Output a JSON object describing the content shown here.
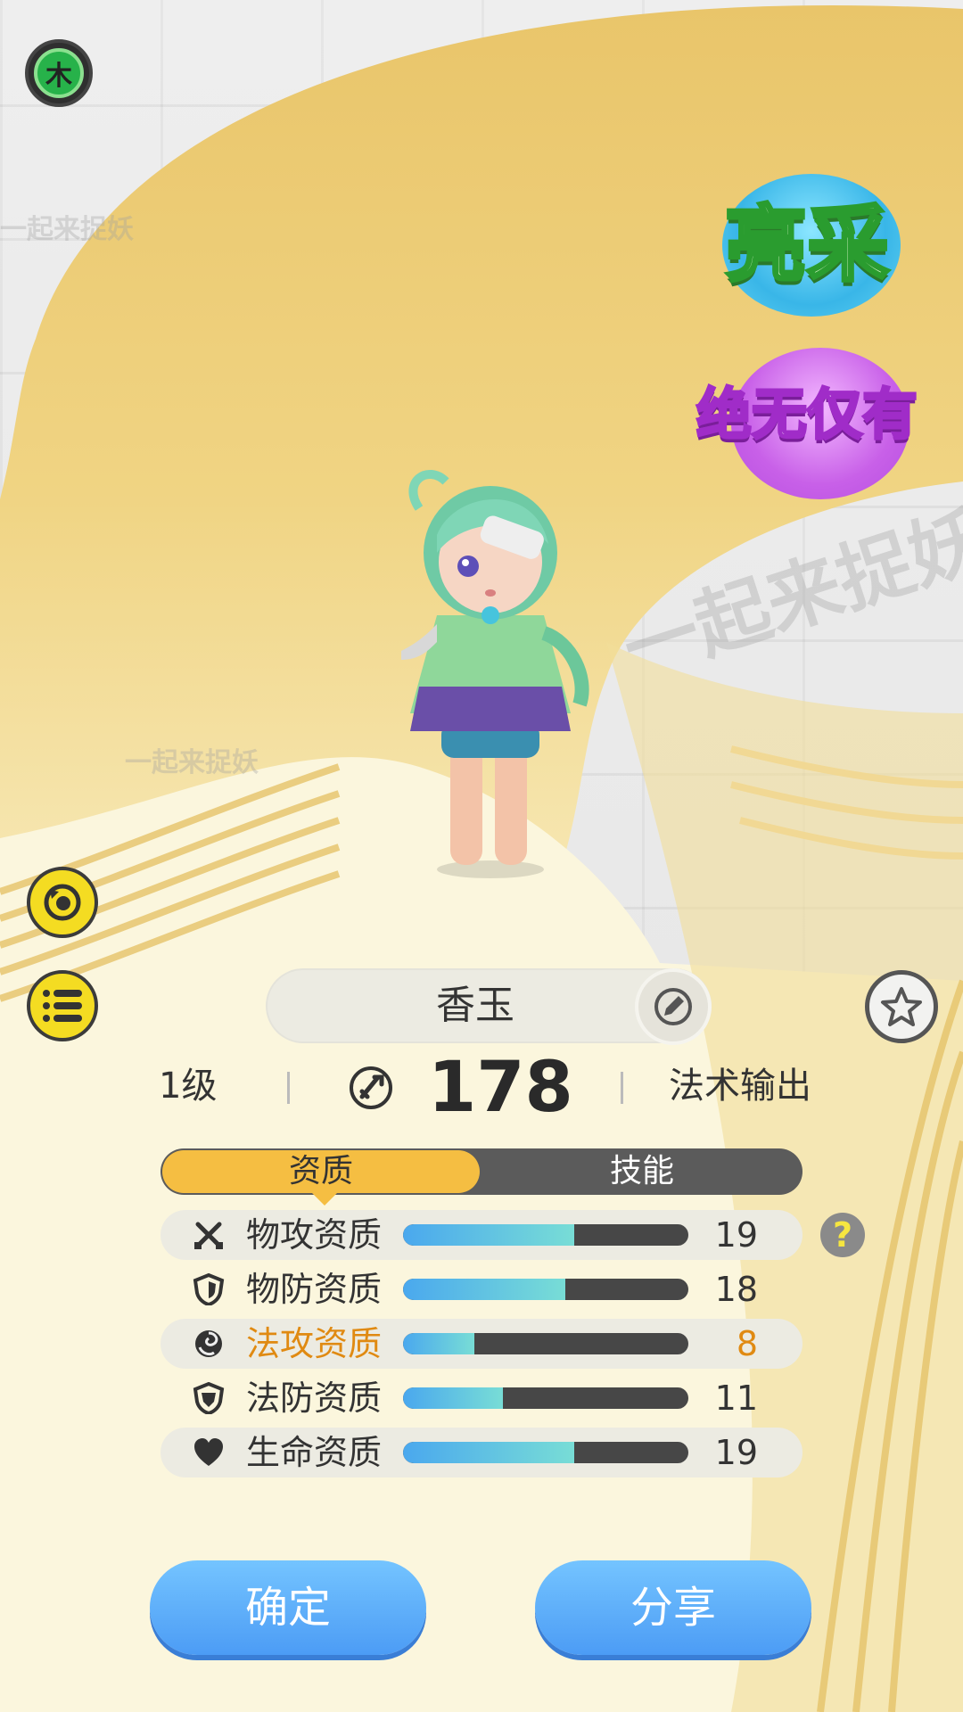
{
  "element_badge": {
    "label": "木",
    "color": "#27b24a"
  },
  "side_buttons": [
    {
      "name": "refresh-pet-icon"
    },
    {
      "name": "list-icon"
    }
  ],
  "badges": {
    "liang": "亮采",
    "jue": "绝无仅有"
  },
  "watermark": "一起来捉妖",
  "character": {
    "alt": "cartoon character with green hair and flower dress"
  },
  "pet": {
    "name": "香玉",
    "level": "1级",
    "power": "178",
    "role": "法术输出"
  },
  "tabs": [
    {
      "label": "资质",
      "active": true
    },
    {
      "label": "技能",
      "active": false
    }
  ],
  "stats": [
    {
      "label": "物攻资质",
      "value": "19",
      "fill": 0.6,
      "icon": "swords-icon",
      "highlight": true,
      "warn": false
    },
    {
      "label": "物防资质",
      "value": "18",
      "fill": 0.57,
      "icon": "shield-icon",
      "highlight": false,
      "warn": false
    },
    {
      "label": "法攻资质",
      "value": "8",
      "fill": 0.25,
      "icon": "magic-swirl-icon",
      "highlight": true,
      "warn": true
    },
    {
      "label": "法防资质",
      "value": "11",
      "fill": 0.35,
      "icon": "magic-shield-icon",
      "highlight": false,
      "warn": false
    },
    {
      "label": "生命资质",
      "value": "19",
      "fill": 0.6,
      "icon": "heart-icon",
      "highlight": true,
      "warn": false
    }
  ],
  "help_label": "?",
  "buttons": {
    "confirm": "确定",
    "share": "分享"
  },
  "colors": {
    "accent": "#f5be42",
    "button": "#5aaaf6",
    "warn": "#e08a12"
  }
}
